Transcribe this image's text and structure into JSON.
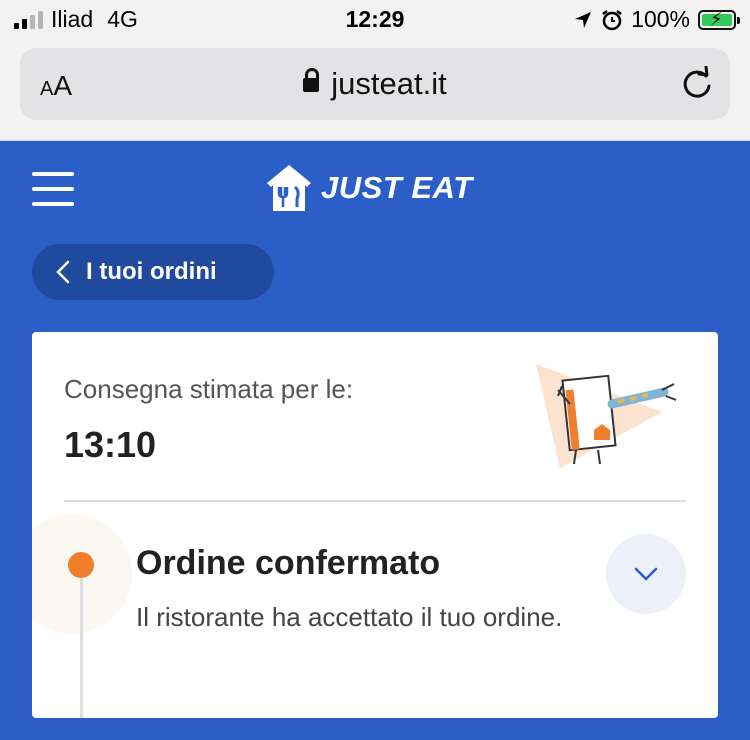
{
  "status_bar": {
    "carrier": "Iliad",
    "network": "4G",
    "time": "12:29",
    "battery": "100%"
  },
  "browser": {
    "text_size_button": "AA",
    "url": "justeat.it"
  },
  "header": {
    "brand": "JUST EAT"
  },
  "back_button": {
    "label": "I tuoi ordini"
  },
  "order": {
    "eta_label": "Consegna stimata per le:",
    "eta_time": "13:10",
    "step": {
      "title": "Ordine confermato",
      "description": "Il ristorante ha accettato il tuo ordine."
    }
  },
  "colors": {
    "brand_blue": "#2b5fc7",
    "pill_blue": "#1f4a9e",
    "status_orange": "#f07f2d",
    "battery_green": "#34c759"
  },
  "icons": [
    "signal-icon",
    "location-arrow-icon",
    "alarm-icon",
    "battery-icon",
    "lock-icon",
    "reload-icon",
    "hamburger-menu-icon",
    "just-eat-logo-icon",
    "chevron-left-icon",
    "chevron-down-icon"
  ]
}
